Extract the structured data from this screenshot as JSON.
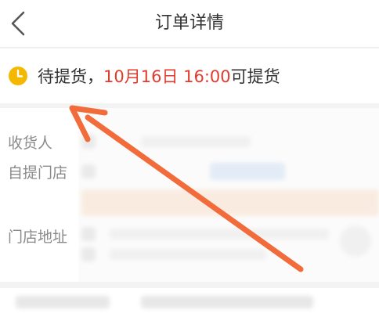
{
  "header": {
    "title": "订单详情",
    "back_icon": "chevron-left-icon"
  },
  "status": {
    "icon": "clock-icon",
    "prefix": "待提货，",
    "highlight": "10月16日 16:00",
    "suffix": "可提货",
    "highlight_color": "#e23b2e",
    "icon_color": "#f5b800"
  },
  "details": {
    "receiver_label": "收货人",
    "pickup_store_label": "自提门店",
    "store_address_label": "门店地址"
  },
  "annotation": {
    "arrow_color": "#f26b3a"
  }
}
